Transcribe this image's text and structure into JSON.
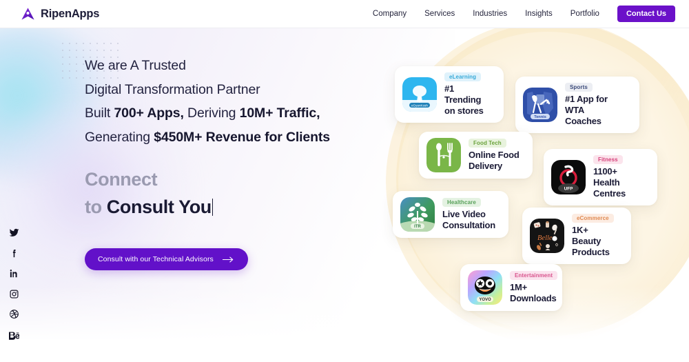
{
  "header": {
    "brand_name": "RipenApps",
    "brand_logo_icon": "ripenapps-arrow-logo-icon",
    "nav_items": [
      {
        "label": "Company"
      },
      {
        "label": "Services"
      },
      {
        "label": "Industries"
      },
      {
        "label": "Insights"
      },
      {
        "label": "Portfolio"
      }
    ],
    "cta_label": "Contact Us",
    "cta_color": "#6b11c9"
  },
  "hero": {
    "headline": {
      "line1": "We are A Trusted",
      "line2": "Digital Transformation Partner",
      "line3_a": "Built ",
      "line3_b": "700+ Apps,",
      "line3_c": " Deriving ",
      "line3_d": "10M+ Traffic,",
      "line4_a": "Generating ",
      "line4_b": "$450M+ Revenue for Clients"
    },
    "subhead": {
      "line1": "Connect",
      "line2_a": "to ",
      "line2_b": "Consult You"
    },
    "cta_label": "Consult with our Technical Advisors",
    "cta_arrow_icon": "arrow-right-icon",
    "cta_color": "#6211c9"
  },
  "social": [
    {
      "name": "twitter-icon",
      "label": "Twitter"
    },
    {
      "name": "facebook-icon",
      "label": "Facebook"
    },
    {
      "name": "linkedin-icon",
      "label": "LinkedIn"
    },
    {
      "name": "instagram-icon",
      "label": "Instagram"
    },
    {
      "name": "dribbble-icon",
      "label": "Dribbble"
    },
    {
      "name": "behance-icon",
      "label": "Behance"
    }
  ],
  "cards": [
    {
      "tag": "eLearning",
      "tag_bg": "#dff2fb",
      "tag_color": "#36a9d8",
      "title_line1": "#1 Trending",
      "title_line2": "on stores",
      "app_label": "eGyanKosh",
      "icon_name": "elearning-tree-app-icon"
    },
    {
      "tag": "Sports",
      "tag_bg": "#eceef3",
      "tag_color": "#3b4a7a",
      "title_line1": "#1 App for WTA",
      "title_line2": "Coaches",
      "app_label": "Tennis",
      "icon_name": "tennis-app-icon"
    },
    {
      "tag": "Food Tech",
      "tag_bg": "#e8f3dd",
      "tag_color": "#6aa23c",
      "title_line1": "Online Food",
      "title_line2": "Delivery",
      "app_label": "",
      "icon_name": "food-delivery-app-icon"
    },
    {
      "tag": "Fitness",
      "tag_bg": "#fbe4ec",
      "tag_color": "#d6417b",
      "title_line1": "1100+ Health",
      "title_line2": "Centres",
      "app_label": "UFP",
      "icon_name": "ufp-fitness-app-icon"
    },
    {
      "tag": "Healthcare",
      "tag_bg": "#e4f2e2",
      "tag_color": "#58a05a",
      "title_line1": "Live Video",
      "title_line2": "Consultation",
      "app_label": "ITR",
      "icon_name": "itr-healthcare-app-icon"
    },
    {
      "tag": "eCommerce",
      "tag_bg": "#fcece2",
      "tag_color": "#e08a52",
      "title_line1": "1K+ Beauty",
      "title_line2": "Products",
      "app_label": "Belle",
      "icon_name": "belle-beauty-app-icon"
    },
    {
      "tag": "Entertainment",
      "tag_bg": "#fbe3ee",
      "tag_color": "#d8538c",
      "title_line1": "1M+",
      "title_line2": "Downloads",
      "app_label": "YOVO",
      "icon_name": "yovo-entertainment-app-icon"
    }
  ]
}
